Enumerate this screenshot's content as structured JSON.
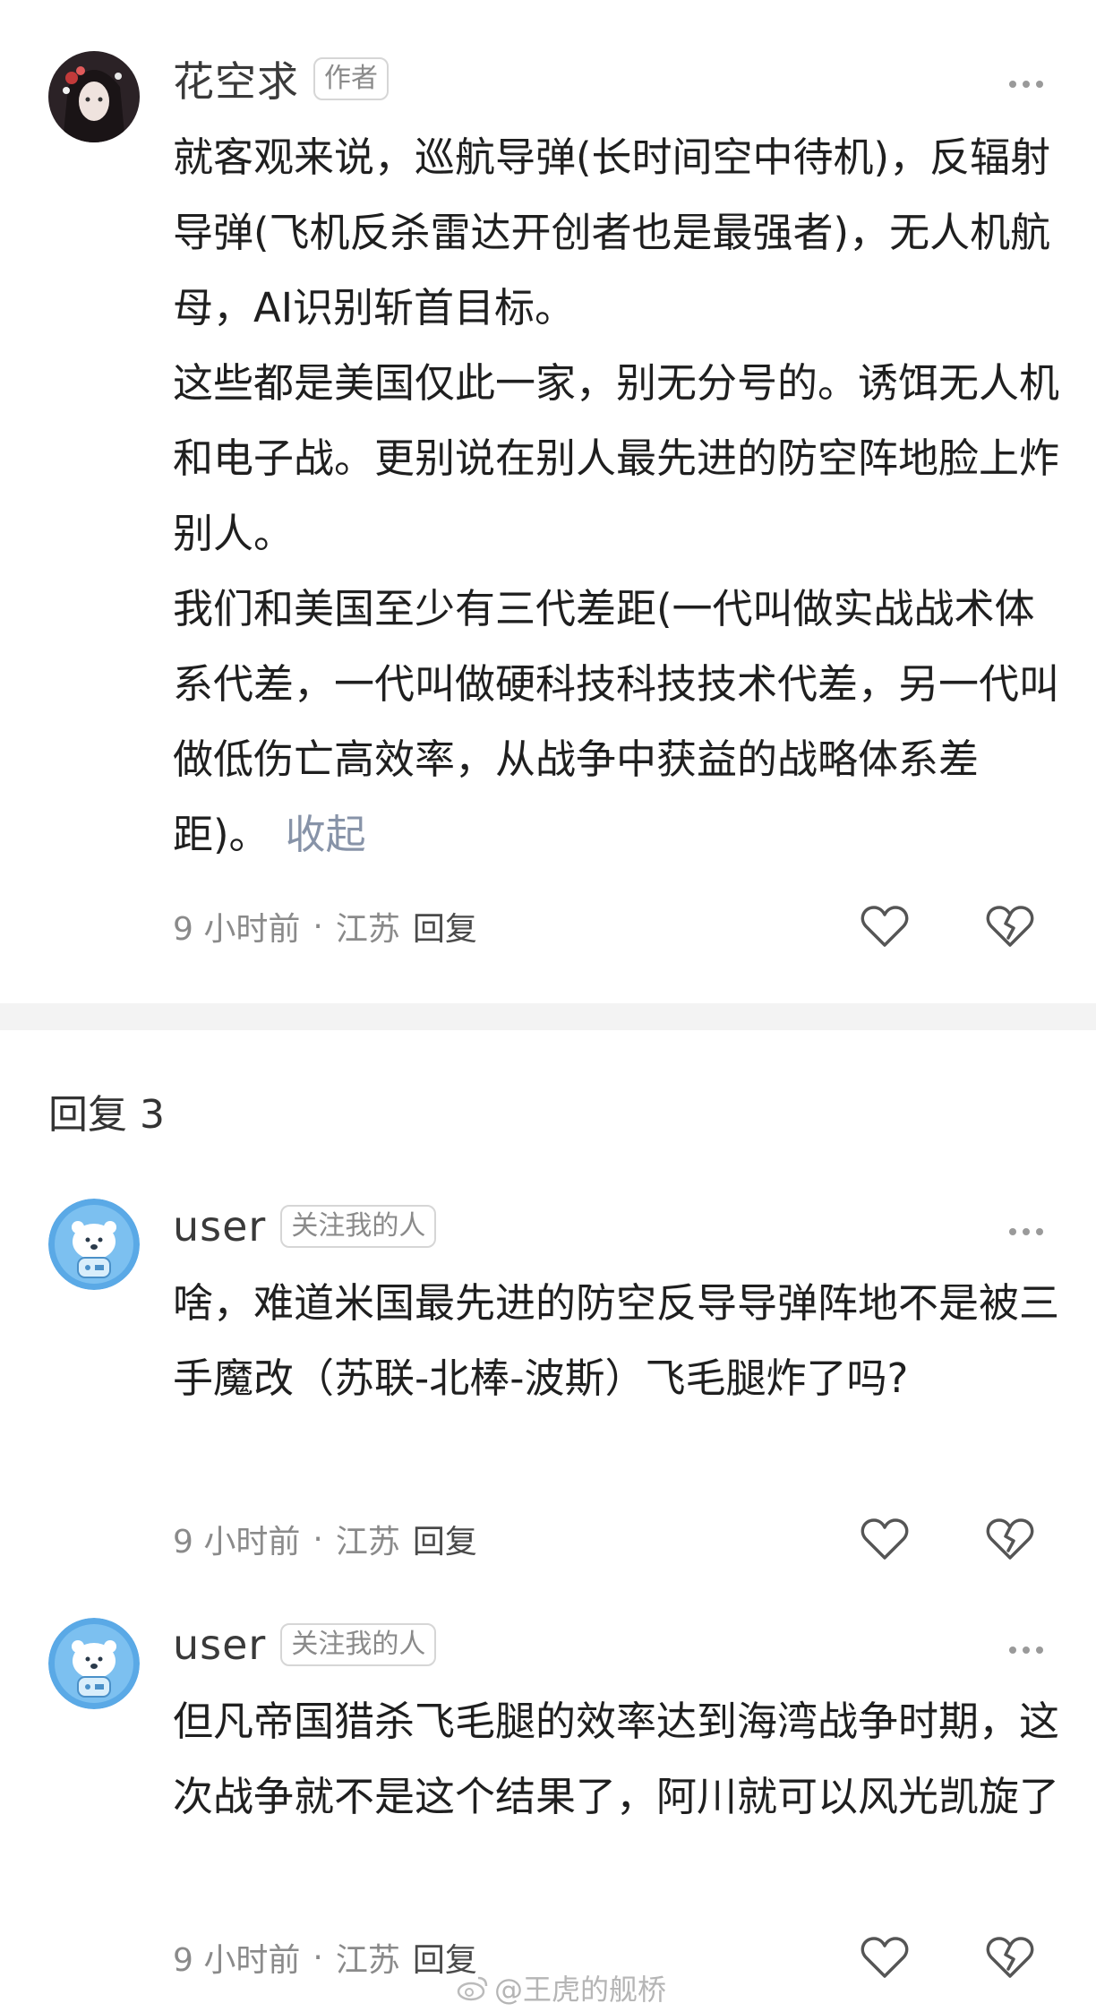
{
  "comments_top": {
    "username": "花空求",
    "tag": "作者",
    "more": "···",
    "paragraphs": [
      "就客观来说，巡航导弹(长时间空中待机)，反辐射导弹(飞机反杀雷达开创者也是最强者)，无人机航母，AI识别斩首目标。",
      "这些都是美国仅此一家，别无分号的。诱饵无人机和电子战。更别说在别人最先进的防空阵地脸上炸别人。",
      "我们和美国至少有三代差距(一代叫做实战战术体系代差，一代叫做硬科技科技技术代差，另一代叫做低伤亡高效率，从战争中获益的战略体系差距)。"
    ],
    "collapse_label": "收起",
    "time": "9 小时前",
    "location": "江苏",
    "reply_label": "回复"
  },
  "replies_section": {
    "title": "回复 3"
  },
  "replies": [
    {
      "username": "user",
      "tag": "关注我的人",
      "more": "···",
      "text": "啥，难道米国最先进的防空反导导弹阵地不是被三手魔改（苏联-北棒-波斯）飞毛腿炸了吗?",
      "time": "9 小时前",
      "location": "江苏",
      "reply_label": "回复"
    },
    {
      "username": "user",
      "tag": "关注我的人",
      "more": "···",
      "text": "但凡帝国猎杀飞毛腿的效率达到海湾战争时期，这次战争就不是这个结果了，阿川就可以风光凯旋了",
      "time": "9 小时前",
      "location": "江苏",
      "reply_label": "回复"
    }
  ],
  "watermark": "@王虎的舰桥",
  "colors": {
    "text": "#1f1f1f",
    "meta": "#8a8a8a",
    "collapse": "#8793a8",
    "band": "#f3f3f3"
  },
  "icons": [
    "like-heart-icon",
    "dislike-broken-heart-icon",
    "more-dots-icon",
    "weibo-logo-icon"
  ]
}
